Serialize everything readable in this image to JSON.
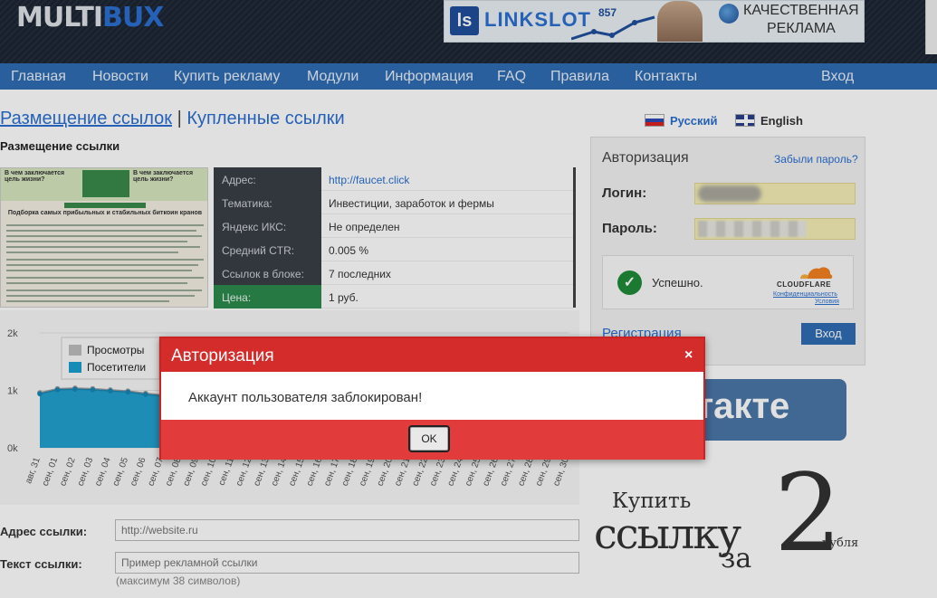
{
  "header": {
    "logo_part1": "MULTI",
    "logo_part2": "BUX",
    "banner": {
      "brand": "LINKSLOT",
      "brand_mark": "ls",
      "number": "857",
      "slogan_line1": "КАЧЕСТВЕННАЯ",
      "slogan_line2": "РЕКЛАМА"
    }
  },
  "nav": {
    "items": [
      "Главная",
      "Новости",
      "Купить рекламу",
      "Модули",
      "Информация",
      "FAQ",
      "Правила",
      "Контакты"
    ],
    "login": "Вход"
  },
  "tabs": {
    "placement": "Размещение ссылок",
    "separator": "|",
    "bought": "Купленные ссылки"
  },
  "section_title": "Размещение ссылки",
  "thumbnail": {
    "banner_left": "В чем заключается цель жизни?",
    "banner_right": "В чем заключается цель жизни?",
    "heading": "Подборка самых прибыльных и стабильных биткоин кранов"
  },
  "info": {
    "rows": [
      {
        "label": "Адрес:",
        "value": "http://faucet.click"
      },
      {
        "label": "Тематика:",
        "value": "Инвестиции, заработок и фермы"
      },
      {
        "label": "Яндекс ИКС:",
        "value": "Не определен"
      },
      {
        "label": "Средний CTR:",
        "value": "0.005 %"
      },
      {
        "label": "Ссылок в блоке:",
        "value": "7 последних"
      },
      {
        "label": "Цена:",
        "value": "1 руб."
      }
    ]
  },
  "chart_data": {
    "type": "area",
    "title": "",
    "xlabel": "",
    "ylabel": "",
    "ylim": [
      0,
      2000
    ],
    "y_ticks": [
      "0k",
      "1k",
      "2k"
    ],
    "categories": [
      "авг, 31",
      "сен, 01",
      "сен, 02",
      "сен, 03",
      "сен, 04",
      "сен, 05",
      "сен, 06",
      "сен, 07",
      "сен, 08",
      "сен, 09",
      "сен, 10",
      "сен, 11",
      "сен, 12",
      "сен, 13",
      "сен, 14",
      "сен, 15",
      "сен, 16",
      "сен, 17",
      "сен, 18",
      "сен, 19",
      "сен, 20",
      "сен, 21",
      "сен, 22",
      "сен, 23",
      "сен, 24",
      "сен, 25",
      "сен, 26",
      "сен, 27",
      "сен, 28",
      "сен, 29",
      "сен, 30"
    ],
    "series": [
      {
        "name": "Просмотры",
        "color": "#bdbdbd",
        "values": [
          960,
          1030,
          1040,
          1030,
          1010,
          990,
          950,
          920,
          900,
          900,
          890,
          890,
          880,
          880,
          880,
          870,
          870,
          870,
          870,
          860,
          860,
          860,
          860,
          860,
          860,
          850,
          850,
          850,
          850,
          850,
          850
        ]
      },
      {
        "name": "Посетители",
        "color": "#1a9fd0",
        "values": [
          940,
          1010,
          1020,
          1010,
          990,
          970,
          930,
          900,
          880,
          880,
          870,
          870,
          860,
          860,
          860,
          850,
          850,
          850,
          850,
          840,
          840,
          840,
          840,
          840,
          840,
          830,
          830,
          830,
          830,
          830,
          830
        ]
      }
    ],
    "legend_position": "top-left",
    "grid": true
  },
  "form": {
    "url_label": "Адрес ссылки:",
    "url_placeholder": "http://website.ru",
    "text_label": "Текст ссылки:",
    "text_placeholder": "Пример рекламной ссылки",
    "text_hint": "(максимум 38 символов)"
  },
  "languages": {
    "ru": "Русский",
    "en": "English"
  },
  "auth": {
    "title": "Авторизация",
    "forgot": "Забыли пароль?",
    "login_label": "Логин:",
    "password_label": "Пароль:",
    "captcha_status": "Успешно.",
    "captcha_brand": "CLOUDFLARE",
    "captcha_privacy": "Конфиденциальность",
    "captcha_terms": "Условия",
    "register": "Регистрация",
    "submit": "Вход"
  },
  "vk": {
    "text": "онтакте"
  },
  "promo": {
    "line1": "Купить",
    "line2": "ссылку",
    "line3": "за",
    "number": "2",
    "unit": "рубля"
  },
  "modal": {
    "title": "Авторизация",
    "close": "×",
    "message": "Аккаунт пользователя заблокирован!",
    "ok": "OK"
  },
  "colors": {
    "nav_bg": "#2f6db2",
    "modal_red": "#d42b2b",
    "link_blue": "#2a6fd1"
  }
}
